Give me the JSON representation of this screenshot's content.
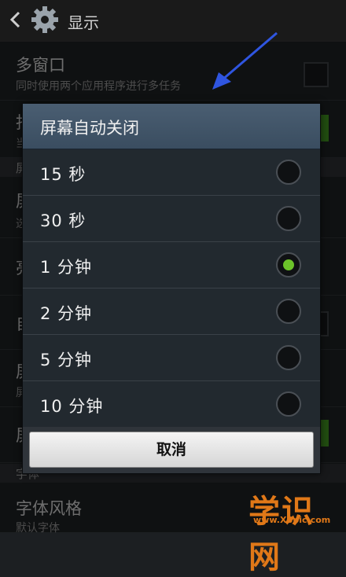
{
  "actionbar": {
    "title": "显示"
  },
  "background": {
    "multiwindow_title": "多窗口",
    "multiwindow_sub": "同时使用两个应用程序进行多任务",
    "partial_rows": [
      "指",
      "当",
      "屏",
      "屏",
      "选",
      "亮",
      "自",
      "屏",
      "屏",
      "屏"
    ],
    "section_font": "字体",
    "font_style_title": "字体风格",
    "font_style_sub": "默认字体"
  },
  "dialog": {
    "title": "屏幕自动关闭",
    "options": [
      {
        "label": "15 秒",
        "selected": false
      },
      {
        "label": "30 秒",
        "selected": false
      },
      {
        "label": "1 分钟",
        "selected": true
      },
      {
        "label": "2 分钟",
        "selected": false
      },
      {
        "label": "5 分钟",
        "selected": false
      },
      {
        "label": "10 分钟",
        "selected": false
      }
    ],
    "cancel_label": "取消"
  },
  "watermark": {
    "text": "学识网",
    "url": "www.XSpic.com"
  },
  "colors": {
    "accent_green": "#6cc32a",
    "arrow_blue": "#2f55e0",
    "watermark": "#e07818"
  }
}
